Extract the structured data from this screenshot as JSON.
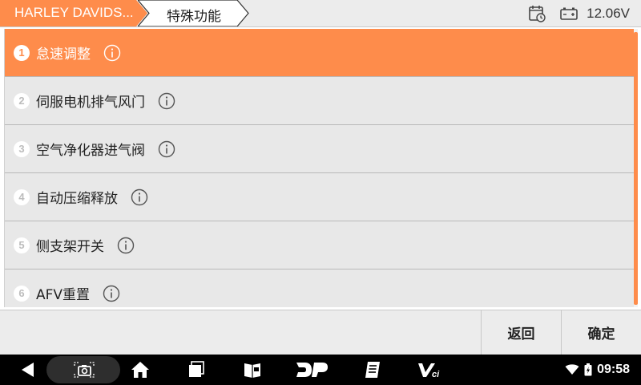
{
  "header": {
    "breadcrumb_brand": "HARLEY DAVIDS...",
    "breadcrumb_section": "特殊功能",
    "voltage": "12.06V",
    "icons": [
      "calendar-clock-icon",
      "battery-icon"
    ]
  },
  "list": {
    "items": [
      {
        "num": "1",
        "label": "怠速调整",
        "active": true
      },
      {
        "num": "2",
        "label": "伺服电机排气风门",
        "active": false
      },
      {
        "num": "3",
        "label": "空气净化器进气阀",
        "active": false
      },
      {
        "num": "4",
        "label": "自动压缩释放",
        "active": false
      },
      {
        "num": "5",
        "label": "侧支架开关",
        "active": false
      },
      {
        "num": "6",
        "label": "AFV重置",
        "active": false
      }
    ]
  },
  "buttons": {
    "back": "返回",
    "ok": "确定"
  },
  "navbar": {
    "icons": [
      "back-icon",
      "screenshot-icon",
      "home-icon",
      "recent-apps-icon",
      "reader-icon",
      "dp-icon",
      "notes-icon",
      "vci-icon"
    ],
    "dp_label": "DP",
    "vci_label": "Vci",
    "time": "09:58"
  },
  "colors": {
    "accent": "#fe8c4b",
    "header_bg": "#ececec",
    "row_bg": "#e8e8e8",
    "navbar_bg": "#000000"
  }
}
